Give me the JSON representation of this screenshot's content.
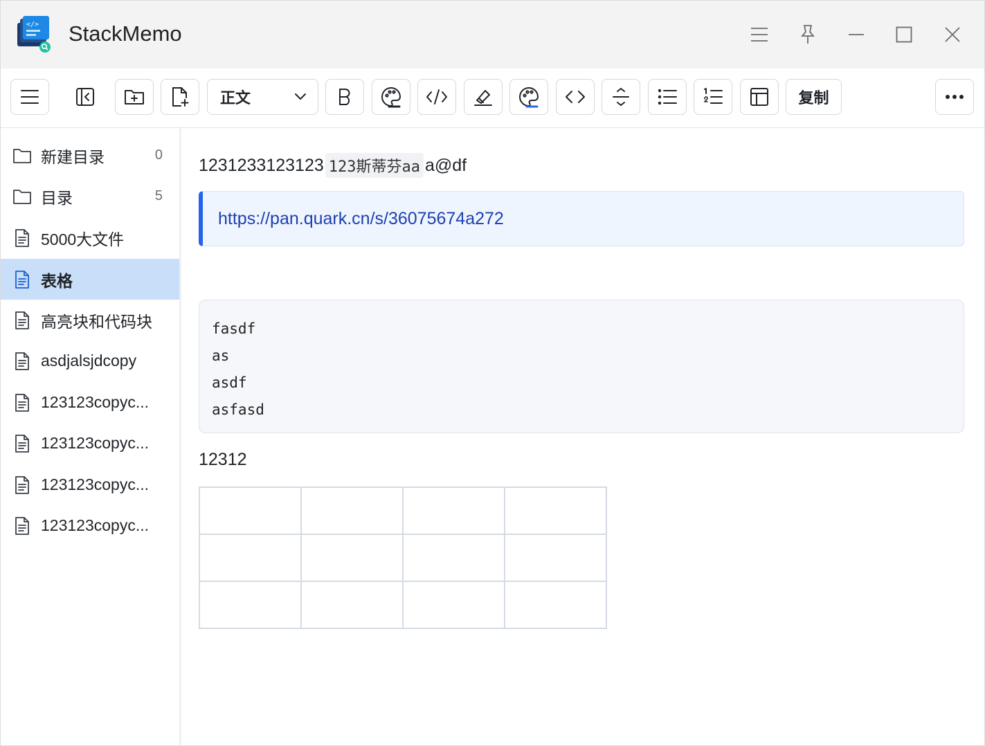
{
  "app": {
    "title": "StackMemo"
  },
  "toolbar": {
    "style_select": "正文",
    "copy_label": "复制"
  },
  "sidebar": {
    "items": [
      {
        "label": "新建目录",
        "type": "folder",
        "count": "0"
      },
      {
        "label": "目录",
        "type": "folder",
        "count": "5"
      },
      {
        "label": "5000大文件",
        "type": "file"
      },
      {
        "label": "表格",
        "type": "file",
        "active": true
      },
      {
        "label": "高亮块和代码块",
        "type": "file"
      },
      {
        "label": "asdjalsjdcopy",
        "type": "file"
      },
      {
        "label": "123123copyc...",
        "type": "file"
      },
      {
        "label": "123123copyc...",
        "type": "file"
      },
      {
        "label": "123123copyc...",
        "type": "file"
      },
      {
        "label": "123123copyc...",
        "type": "file"
      }
    ]
  },
  "editor": {
    "line1_text": "1231233123123",
    "line1_code": "123斯蒂芬aa",
    "line1_tail": "a@df",
    "callout_link": "https://pan.quark.cn/s/36075674a272",
    "code_lines": [
      "fasdf",
      "as",
      "asdf",
      "asfasd"
    ],
    "para2": "12312",
    "table": {
      "rows": 3,
      "cols": 4
    }
  },
  "colors": {
    "accent": "#2563eb",
    "sidebar_active_bg": "#c9def8",
    "titlebar_bg": "#f3f3f3"
  }
}
